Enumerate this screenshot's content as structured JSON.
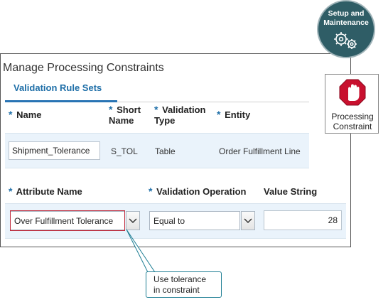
{
  "setup": {
    "line1": "Setup and",
    "line2": "Maintenance"
  },
  "constraint_icon": {
    "line1": "Processing",
    "line2": "Constraint"
  },
  "page": {
    "title": "Manage Processing Constraints"
  },
  "tabs": [
    {
      "label": "Validation Rule Sets"
    }
  ],
  "rule_set_table": {
    "columns": [
      {
        "required": "*",
        "label": "Name"
      },
      {
        "required": "*",
        "label_line1": "Short",
        "label_line2": "Name"
      },
      {
        "required": "*",
        "label_line1": "Validation",
        "label_line2": "Type"
      },
      {
        "required": "*",
        "label": "Entity"
      }
    ],
    "row": {
      "name": "Shipment_Tolerance",
      "short_name": "S_TOL",
      "validation_type": "Table",
      "entity": "Order Fulfillment Line"
    }
  },
  "rules_table": {
    "columns": [
      {
        "required": "*",
        "label": "Attribute Name"
      },
      {
        "required": "*",
        "label": "Validation Operation"
      },
      {
        "required": "",
        "label": "Value String"
      }
    ],
    "row": {
      "attribute_name": "Over Fulfillment Tolerance",
      "validation_operation": "Equal to",
      "value_string": "28"
    }
  },
  "callout": {
    "line1": "Use tolerance",
    "line2": "in constraint"
  },
  "icons": [
    "gears-icon",
    "stop-hand-icon",
    "chevron-down-icon"
  ],
  "colors": {
    "accent": "#1f6fa8",
    "highlight": "#c0283a",
    "circle": "#2f5d66",
    "band": "#eaf3fb",
    "stop": "#c8102e"
  }
}
